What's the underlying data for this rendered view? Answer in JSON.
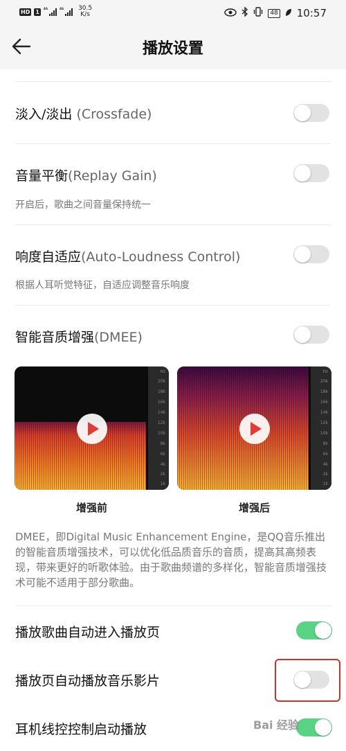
{
  "status_bar": {
    "left_badges": [
      "HD",
      "1"
    ],
    "network_1": "4G",
    "network_2": "4G",
    "speed": "30.5",
    "speed_unit": "K/s",
    "battery": "48",
    "time": "10:57"
  },
  "header": {
    "title": "播放设置"
  },
  "settings": [
    {
      "label": "淡入/淡出",
      "label_en": " (Crossfade)",
      "on": false
    },
    {
      "label": "音量平衡",
      "label_en": "(Replay Gain)",
      "sub": "开启后，歌曲之间音量保持统一",
      "on": false
    },
    {
      "label": "响度自适应",
      "label_en": "(Auto-Loudness Control)",
      "sub": "根据人耳听觉特征，自适应调整音乐响度",
      "on": false
    },
    {
      "label": "智能音质增强",
      "label_en": "(DMEE)",
      "on": false
    }
  ],
  "dmee": {
    "before_caption": "增强前",
    "after_caption": "增强后",
    "scale_ticks": [
      "Hz",
      "20k",
      "18k",
      "16k",
      "14k",
      "12k",
      "10k",
      "8k",
      "6k",
      "4k",
      "2k",
      "1k"
    ],
    "description": "DMEE，即Digital Music Enhancement Engine，是QQ音乐推出的智能音质增强技术，可以优化低品质音乐的音质，提高其高频表现，带来更好的听歌体验。由于歌曲频谱的多样化，智能音质增强技术可能不适用于部分歌曲。"
  },
  "bottom_settings": [
    {
      "label": "播放歌曲自动进入播放页",
      "on": true
    },
    {
      "label": "播放页自动播放音乐影片",
      "on": false
    },
    {
      "label": "耳机线控控制启动播放",
      "on": true
    }
  ],
  "watermark": "Bai 经验",
  "colors": {
    "toggle_on": "#5ad385",
    "toggle_off": "#e2e2e2",
    "highlight": "#d0302a"
  }
}
